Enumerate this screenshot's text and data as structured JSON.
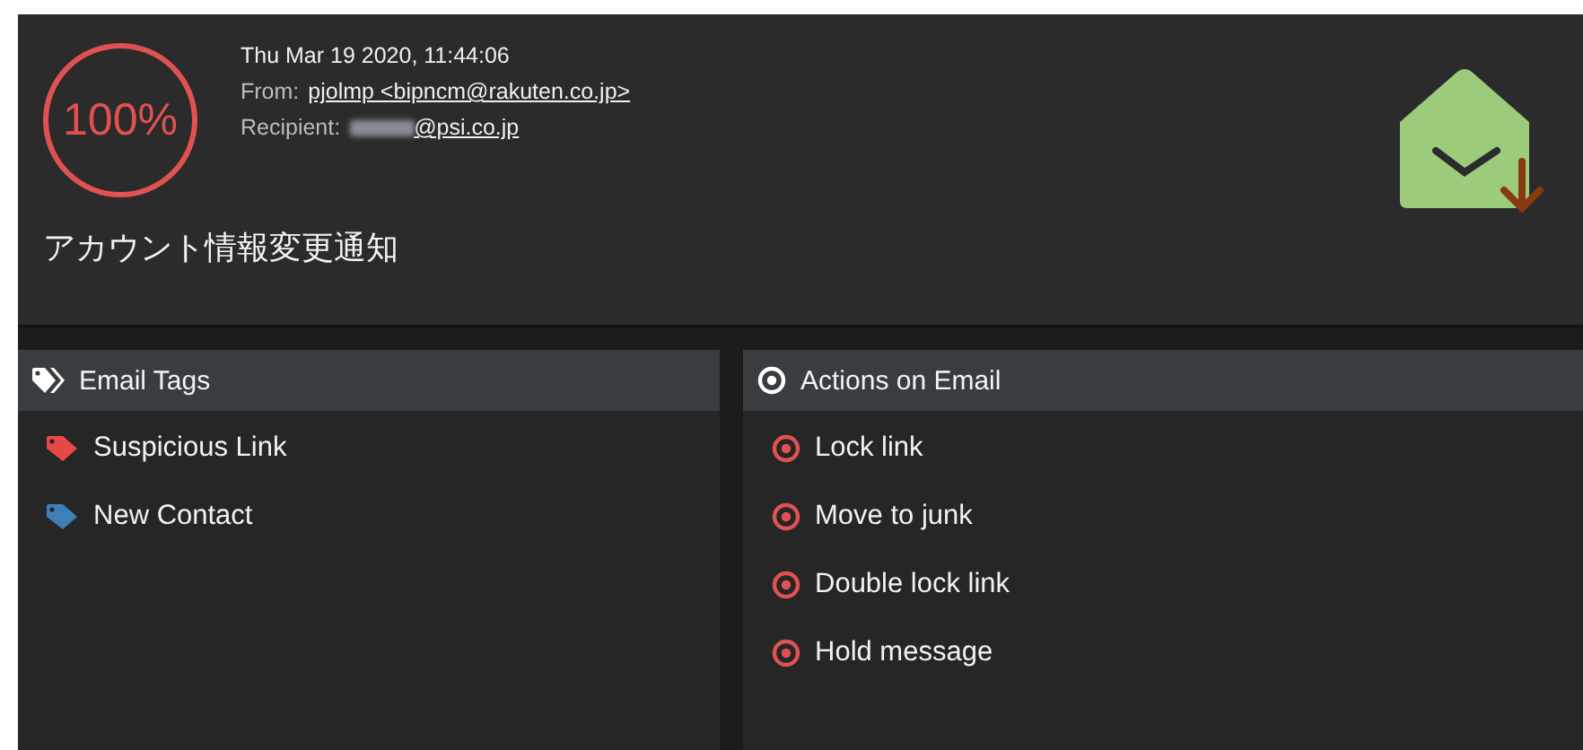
{
  "header": {
    "score": "100%",
    "date": "Thu Mar 19 2020, 11:44:06",
    "from_label": "From:",
    "from": "pjolmp <bipncm@rakuten.co.jp>",
    "recipient_label": "Recipient:",
    "recipient_redacted": true,
    "recipient": "@psi.co.jp",
    "subject": "アカウント情報変更通知"
  },
  "tags_panel": {
    "title": "Email Tags",
    "items": [
      {
        "label": "Suspicious Link",
        "color": "#e84848"
      },
      {
        "label": "New Contact",
        "color": "#3f7fb8"
      }
    ]
  },
  "actions_panel": {
    "title": "Actions on Email",
    "items": [
      {
        "label": "Lock link"
      },
      {
        "label": "Move to junk"
      },
      {
        "label": "Double lock link"
      },
      {
        "label": "Hold message"
      }
    ]
  }
}
